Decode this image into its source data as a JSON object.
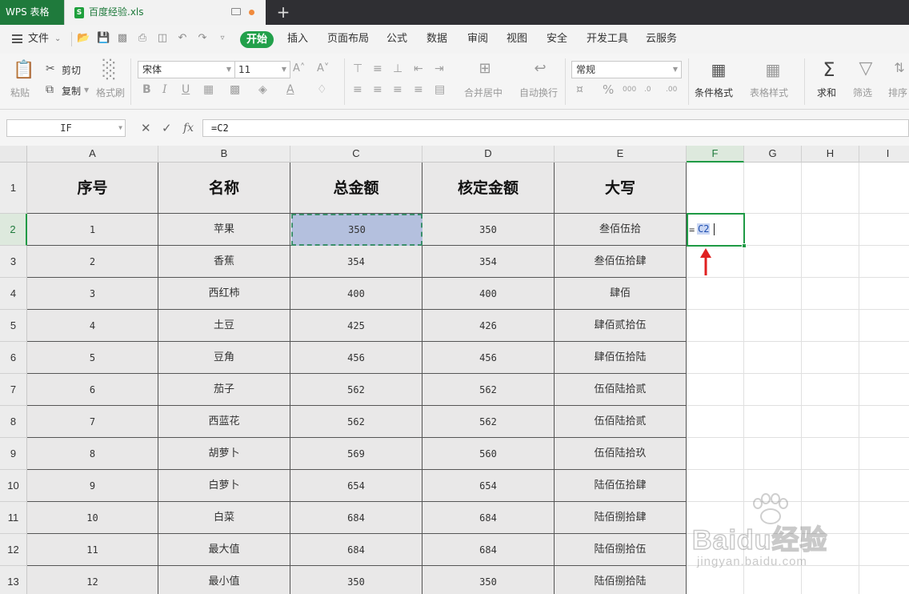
{
  "app": {
    "title": "WPS 表格"
  },
  "document_tab": {
    "name": "百度经验.xls"
  },
  "menu": {
    "file": "文件",
    "items": [
      "开始",
      "插入",
      "页面布局",
      "公式",
      "数据",
      "审阅",
      "视图",
      "安全",
      "开发工具",
      "云服务"
    ],
    "active": "开始"
  },
  "ribbon": {
    "paste": "粘贴",
    "cut": "剪切",
    "copy": "复制",
    "format_painter": "格式刷",
    "font_name": "宋体",
    "font_size": "11",
    "merge_center": "合并居中",
    "auto_wrap": "自动换行",
    "number_format": "常规",
    "conditional_format": "条件格式",
    "table_style": "表格样式",
    "sum": "求和",
    "filter": "筛选",
    "sort": "排序"
  },
  "formula_bar": {
    "name_box": "IF",
    "fx_label": "fx",
    "formula": "=C2"
  },
  "grid": {
    "columns": [
      "A",
      "B",
      "C",
      "D",
      "E",
      "F",
      "G",
      "H",
      "I"
    ],
    "selected_column": "F",
    "rows": [
      "1",
      "2",
      "3",
      "4",
      "5",
      "6",
      "7",
      "8",
      "9",
      "10",
      "11",
      "12",
      "13"
    ],
    "selected_row": "2",
    "table_header": [
      "序号",
      "名称",
      "总金额",
      "核定金额",
      "大写"
    ],
    "table_rows": [
      [
        "1",
        "苹果",
        "350",
        "350",
        "叁佰伍拾"
      ],
      [
        "2",
        "香蕉",
        "354",
        "354",
        "叁佰伍拾肆"
      ],
      [
        "3",
        "西红柿",
        "400",
        "400",
        "肆佰"
      ],
      [
        "4",
        "土豆",
        "425",
        "426",
        "肆佰贰拾伍"
      ],
      [
        "5",
        "豆角",
        "456",
        "456",
        "肆佰伍拾陆"
      ],
      [
        "6",
        "茄子",
        "562",
        "562",
        "伍佰陆拾贰"
      ],
      [
        "7",
        "西蓝花",
        "562",
        "562",
        "伍佰陆拾贰"
      ],
      [
        "8",
        "胡萝卜",
        "569",
        "560",
        "伍佰陆拾玖"
      ],
      [
        "9",
        "白萝卜",
        "654",
        "654",
        "陆佰伍拾肆"
      ],
      [
        "10",
        "白菜",
        "684",
        "684",
        "陆佰捌拾肆"
      ],
      [
        "11",
        "最大值",
        "684",
        "684",
        "陆佰捌拾伍"
      ],
      [
        "12",
        "最小值",
        "350",
        "350",
        "陆佰捌拾陆"
      ]
    ],
    "editing_cell": {
      "equals": "=",
      "reference": "C2"
    }
  },
  "watermark": {
    "brand": "Baidu经验",
    "url": "jingyan.baidu.com"
  },
  "colors": {
    "accent": "#22a04b",
    "title_bar": "#2f2f33",
    "copy_range": "#b4c0de",
    "reference_text": "#1e4fb0",
    "arrow": "#e02020"
  }
}
